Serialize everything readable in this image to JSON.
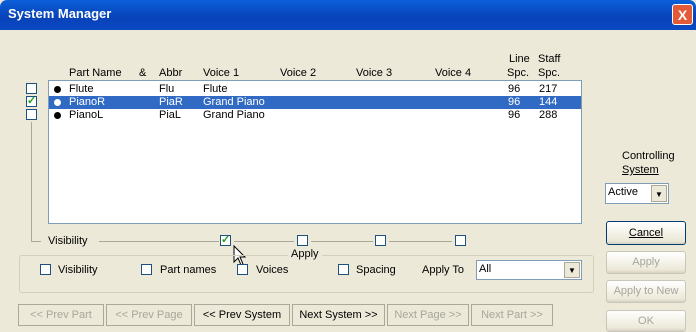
{
  "window": {
    "title": "System Manager",
    "close_glyph": "X"
  },
  "columns": {
    "part_name": "Part Name",
    "amp": "&",
    "abbr": "Abbr",
    "voice1": "Voice 1",
    "voice2": "Voice 2",
    "voice3": "Voice 3",
    "voice4": "Voice 4",
    "line_spc_top": "Line",
    "line_spc_bottom": "Spc.",
    "staff_spc_top": "Staff",
    "staff_spc_bottom": "Spc."
  },
  "parts": [
    {
      "name": "Flute",
      "abbr": "Flu",
      "voice1": "Flute",
      "line_spc": "96",
      "staff_spc": "217",
      "checked": false,
      "selected": false
    },
    {
      "name": "PianoR",
      "abbr": "PiaR",
      "voice1": "Grand Piano",
      "line_spc": "96",
      "staff_spc": "144",
      "checked": true,
      "selected": true
    },
    {
      "name": "PianoL",
      "abbr": "PiaL",
      "voice1": "Grand Piano",
      "line_spc": "96",
      "staff_spc": "288",
      "checked": false,
      "selected": false
    }
  ],
  "visibility": {
    "label": "Visibility",
    "voice1_checked": true,
    "voice2_checked": false,
    "voice3_checked": false,
    "voice4_checked": false
  },
  "controlling_system": {
    "label_line1": "Controlling",
    "label_line2": "System",
    "value": "Active"
  },
  "apply_group": {
    "title": "Apply",
    "visibility": "Visibility",
    "part_names": "Part names",
    "voices": "Voices",
    "spacing": "Spacing",
    "apply_to_label": "Apply To",
    "apply_to_value": "All"
  },
  "buttons": {
    "cancel": "Cancel",
    "apply": "Apply",
    "apply_to_new": "Apply to New",
    "ok": "OK"
  },
  "nav": {
    "prev_part": "<< Prev Part",
    "prev_page": "<< Prev Page",
    "prev_system": "<< Prev System",
    "next_system": "Next System >>",
    "next_page": "Next Page >>",
    "next_part": "Next Part >>"
  },
  "icons": {
    "bullet": "part-bullet-icon",
    "cursor": "mouse-pointer-icon",
    "dropdown": "chevron-down-icon"
  },
  "colors": {
    "title_bar": "#0842b8",
    "selection": "#316ac5",
    "background": "#ece9d8",
    "close": "#e25a38"
  }
}
